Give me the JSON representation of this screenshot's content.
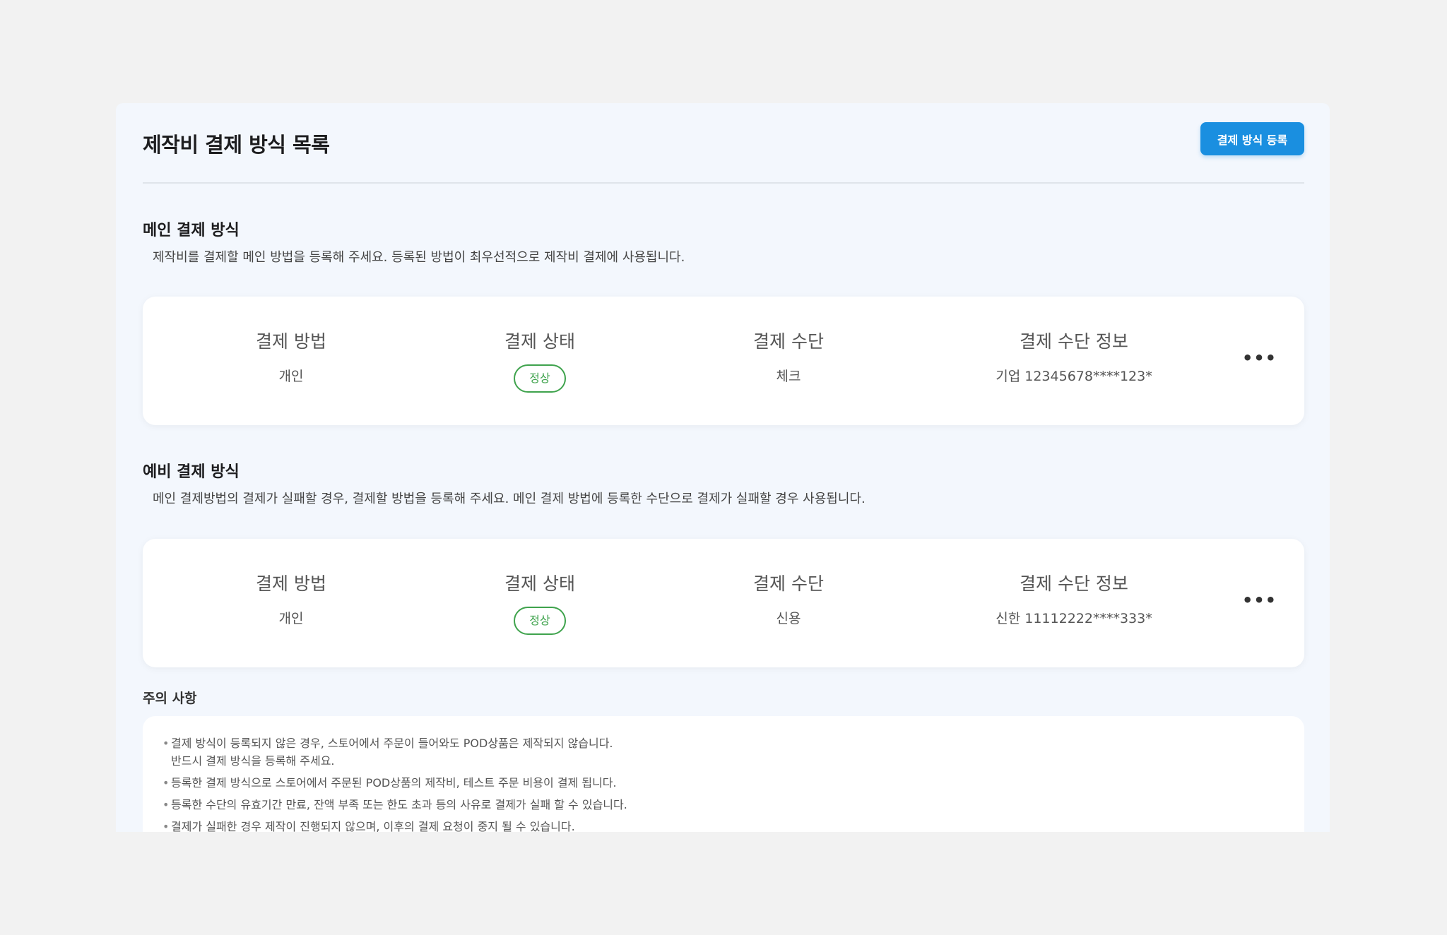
{
  "header": {
    "title": "제작비 결제 방식 목록",
    "register_button": "결제 방식 등록"
  },
  "main_section": {
    "title": "메인 결제 방식",
    "description": "제작비를 결제할 메인 방법을 등록해 주세요. 등록된 방법이 최우선적으로 제작비 결제에 사용됩니다.",
    "columns": [
      "결제 방법",
      "결제 상태",
      "결제 수단",
      "결제 수단 정보"
    ],
    "values": {
      "method": "개인",
      "status": "정상",
      "means": "체크",
      "info": "기업 12345678****123*"
    },
    "more_label": "•••"
  },
  "backup_section": {
    "title": "예비 결제 방식",
    "description": "메인 결제방법의 결제가 실패할 경우, 결제할 방법을 등록해 주세요. 메인 결제 방법에 등록한 수단으로 결제가 실패할 경우 사용됩니다.",
    "columns": [
      "결제 방법",
      "결제 상태",
      "결제 수단",
      "결제 수단 정보"
    ],
    "values": {
      "method": "개인",
      "status": "정상",
      "means": "신용",
      "info": "신한 11112222****333*"
    },
    "more_label": "•••"
  },
  "notice": {
    "title": "주의 사항",
    "items": [
      {
        "line1": "결제 방식이 등록되지 않은 경우, 스토어에서 주문이 들어와도 POD상품은 제작되지 않습니다.",
        "line2": "반드시 결제 방식을 등록해 주세요."
      },
      {
        "line1": "등록한 결제 방식으로 스토어에서 주문된 POD상품의 제작비, 테스트 주문 비용이 결제 됩니다."
      },
      {
        "line1": "등록한 수단의 유효기간 만료, 잔액 부족 또는 한도 초과 등의 사유로 결제가 실패 할 수 있습니다."
      },
      {
        "line1": "결제가 실패한 경우 제작이 진행되지 않으며, 이후의 결제 요청이 중지 될 수 있습니다."
      }
    ]
  },
  "colors": {
    "accent": "#1a8fe0",
    "status_ok": "#3fa34d",
    "panel_bg": "#f3f7fd",
    "page_bg": "#f2f2f2"
  }
}
